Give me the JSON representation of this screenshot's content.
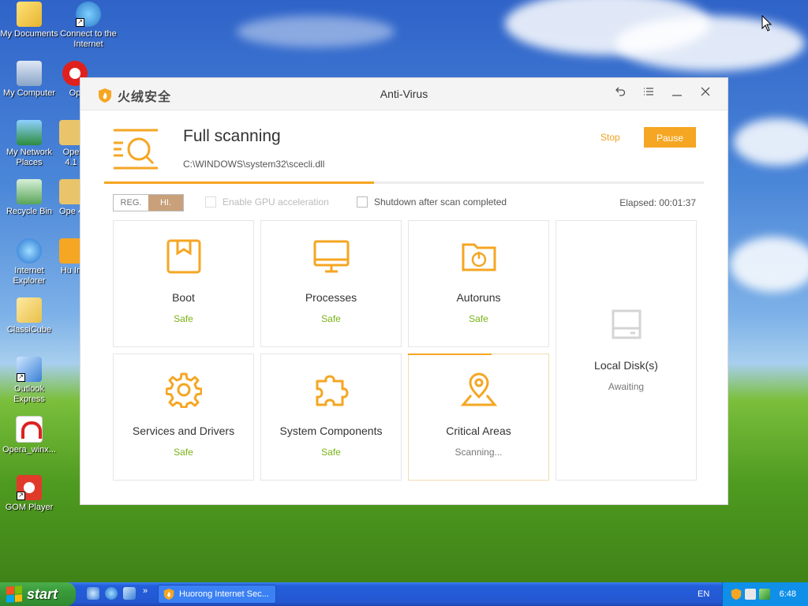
{
  "desktop": {
    "icons": [
      {
        "label": "My Documents",
        "icon": "folder-documents-icon"
      },
      {
        "label": "Connect to the Internet",
        "icon": "internet-connect-icon"
      },
      {
        "label": "My Computer",
        "icon": "computer-icon"
      },
      {
        "label": "Op",
        "icon": "opera-icon"
      },
      {
        "label": "My Network Places",
        "icon": "network-icon"
      },
      {
        "label": "Ope 4.1",
        "icon": "opera-icon"
      },
      {
        "label": "Recycle Bin",
        "icon": "recycle-bin-icon"
      },
      {
        "label": "Ope 4",
        "icon": "opera-icon"
      },
      {
        "label": "Internet Explorer",
        "icon": "ie-icon"
      },
      {
        "label": "Hu In",
        "icon": "huorong-icon"
      },
      {
        "label": "ClassiCube",
        "icon": "folder-icon"
      },
      {
        "label": "Outlook Express",
        "icon": "outlook-icon"
      },
      {
        "label": "Opera_winx...",
        "icon": "opera-installer-icon"
      },
      {
        "label": "GOM Player",
        "icon": "gom-player-icon"
      }
    ]
  },
  "window": {
    "brand": "火绒安全",
    "title": "Anti-Virus",
    "controls": [
      "back-icon",
      "menu-icon",
      "minimize-icon",
      "close-icon"
    ]
  },
  "scan": {
    "title": "Full scanning",
    "path": "C:\\WINDOWS\\system32\\scecli.dll",
    "stop_label": "Stop",
    "pause_label": "Pause",
    "progress": 0.45
  },
  "options": {
    "toggle_left": "REG.",
    "toggle_right": "HI.",
    "gpu_label": "Enable GPU acceleration",
    "shutdown_label": "Shutdown after scan completed",
    "elapsed": "Elapsed: 00:01:37"
  },
  "cards": {
    "boot": {
      "name": "Boot",
      "status": "Safe"
    },
    "processes": {
      "name": "Processes",
      "status": "Safe"
    },
    "autoruns": {
      "name": "Autoruns",
      "status": "Safe"
    },
    "local_disks": {
      "name": "Local Disk(s)",
      "status": "Awaiting"
    },
    "services": {
      "name": "Services and Drivers",
      "status": "Safe"
    },
    "system_components": {
      "name": "System Components",
      "status": "Safe"
    },
    "critical_areas": {
      "name": "Critical Areas",
      "status": "Scanning...",
      "progress": 0.6
    }
  },
  "taskbar": {
    "start_label": "start",
    "task_label": "Huorong Internet Sec...",
    "language": "EN",
    "clock": "6:48"
  },
  "colors": {
    "accent": "#f5a623",
    "safe": "#7ab317"
  }
}
